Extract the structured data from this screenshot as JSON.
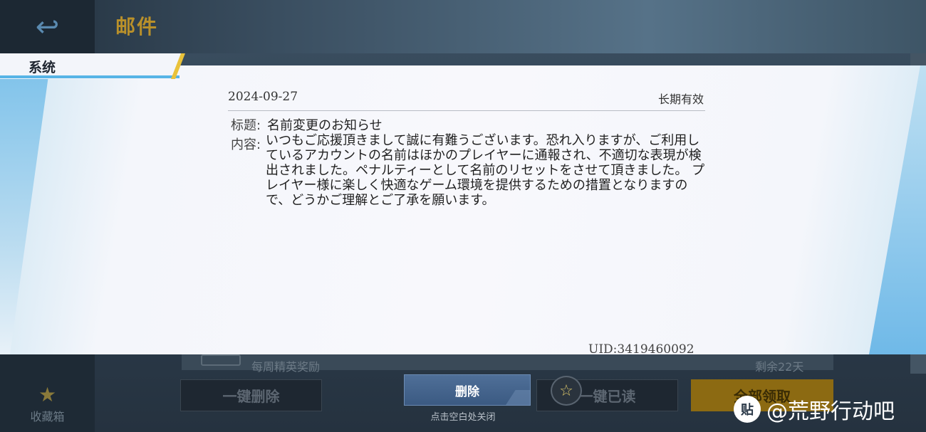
{
  "header": {
    "back_icon": "back-arrow-icon",
    "title": "邮件"
  },
  "sidebar": {
    "favorites_label": "收藏箱",
    "favorites_icon": "star-icon"
  },
  "background_list": {
    "row_text": "每周精英奖励",
    "row_remaining": "剩余22天"
  },
  "actions": {
    "delete_all": "一键删除",
    "read_all": "一键已读",
    "claim_all": "全部领取"
  },
  "modal": {
    "tab_label": "系统",
    "date": "2024-09-27",
    "validity": "长期有效",
    "subject_label": "标题:",
    "subject": "名前変更のお知らせ",
    "content_label": "内容:",
    "content": "いつもご応援頂きまして誠に有難うございます。恐れ入りますが、ご利用しているアカウントの名前はほかのプレイヤーに通報され、不適切な表現が検出されました。ペナルティーとして名前のリセットをさせて頂きました。 プレイヤー様に楽しく快適なゲーム環境を提供するための措置となりますので、どうかご理解とご了承を願います。",
    "uid": "UID:3419460092",
    "delete_button": "删除",
    "close_hint": "点击空白处关闭"
  },
  "watermark": {
    "logo": "贴",
    "text": "@荒野行动吧"
  }
}
